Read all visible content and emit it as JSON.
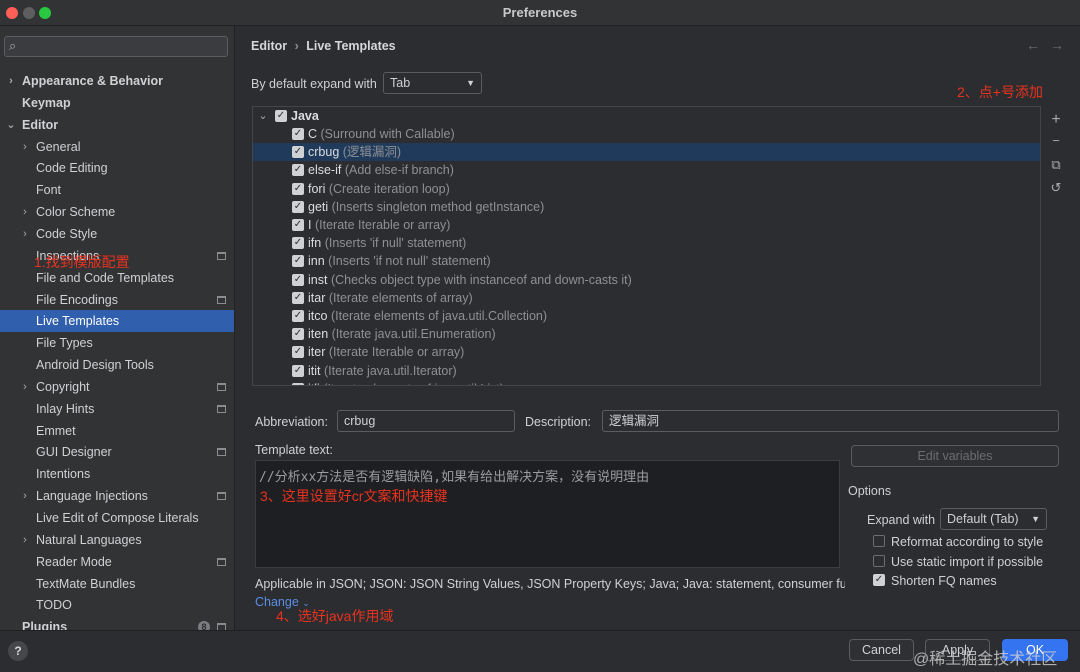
{
  "window": {
    "title": "Preferences"
  },
  "search": {
    "placeholder": ""
  },
  "sidebar": {
    "items": [
      {
        "label": "Appearance & Behavior",
        "level": 0,
        "expandable": true,
        "expanded": false,
        "bold": true
      },
      {
        "label": "Keymap",
        "level": 0,
        "expandable": false,
        "bold": true
      },
      {
        "label": "Editor",
        "level": 0,
        "expandable": true,
        "expanded": true,
        "bold": true
      },
      {
        "label": "General",
        "level": 1,
        "expandable": true
      },
      {
        "label": "Code Editing",
        "level": 1
      },
      {
        "label": "Font",
        "level": 1
      },
      {
        "label": "Color Scheme",
        "level": 1,
        "expandable": true
      },
      {
        "label": "Code Style",
        "level": 1,
        "expandable": true
      },
      {
        "label": "Inspections",
        "level": 1,
        "project_icon": true
      },
      {
        "label": "File and Code Templates",
        "level": 1
      },
      {
        "label": "File Encodings",
        "level": 1,
        "project_icon": true
      },
      {
        "label": "Live Templates",
        "level": 1,
        "selected": true
      },
      {
        "label": "File Types",
        "level": 1
      },
      {
        "label": "Android Design Tools",
        "level": 1
      },
      {
        "label": "Copyright",
        "level": 1,
        "expandable": true,
        "project_icon": true
      },
      {
        "label": "Inlay Hints",
        "level": 1,
        "project_icon": true
      },
      {
        "label": "Emmet",
        "level": 1
      },
      {
        "label": "GUI Designer",
        "level": 1,
        "project_icon": true
      },
      {
        "label": "Intentions",
        "level": 1
      },
      {
        "label": "Language Injections",
        "level": 1,
        "expandable": true,
        "project_icon": true
      },
      {
        "label": "Live Edit of Compose Literals",
        "level": 1
      },
      {
        "label": "Natural Languages",
        "level": 1,
        "expandable": true
      },
      {
        "label": "Reader Mode",
        "level": 1,
        "project_icon": true
      },
      {
        "label": "TextMate Bundles",
        "level": 1
      },
      {
        "label": "TODO",
        "level": 1
      },
      {
        "label": "Plugins",
        "level": 0,
        "bold": true,
        "badge": "8",
        "project_icon": true
      }
    ]
  },
  "breadcrumb": {
    "parent": "Editor",
    "separator": "›",
    "current": "Live Templates"
  },
  "expand_default": {
    "label": "By default expand with",
    "value": "Tab"
  },
  "tree": {
    "group": {
      "name": "Java",
      "checked": true
    },
    "templates": [
      {
        "abbr": "C",
        "desc": "(Surround with Callable)",
        "checked": true
      },
      {
        "abbr": "crbug",
        "desc": "(逻辑漏洞)",
        "checked": true,
        "selected": true
      },
      {
        "abbr": "else-if",
        "desc": "(Add else-if branch)",
        "checked": true
      },
      {
        "abbr": "fori",
        "desc": "(Create iteration loop)",
        "checked": true
      },
      {
        "abbr": "geti",
        "desc": "(Inserts singleton method getInstance)",
        "checked": true
      },
      {
        "abbr": "I",
        "desc": "(Iterate Iterable or array)",
        "checked": true
      },
      {
        "abbr": "ifn",
        "desc": "(Inserts 'if null' statement)",
        "checked": true
      },
      {
        "abbr": "inn",
        "desc": "(Inserts 'if not null' statement)",
        "checked": true
      },
      {
        "abbr": "inst",
        "desc": "(Checks object type with instanceof and down-casts it)",
        "checked": true
      },
      {
        "abbr": "itar",
        "desc": "(Iterate elements of array)",
        "checked": true
      },
      {
        "abbr": "itco",
        "desc": "(Iterate elements of java.util.Collection)",
        "checked": true
      },
      {
        "abbr": "iten",
        "desc": "(Iterate java.util.Enumeration)",
        "checked": true
      },
      {
        "abbr": "iter",
        "desc": "(Iterate Iterable or array)",
        "checked": true
      },
      {
        "abbr": "itit",
        "desc": "(Iterate java.util.Iterator)",
        "checked": true
      },
      {
        "abbr": "itli",
        "desc": "(Iterate elements of java.util.List)",
        "checked": true
      }
    ]
  },
  "toolbar": {
    "add": "+",
    "remove": "−",
    "copy": "⧉",
    "restore": "↺"
  },
  "details": {
    "abbreviation_label": "Abbreviation:",
    "abbreviation_value": "crbug",
    "description_label": "Description:",
    "description_value": "逻辑漏洞",
    "template_text_label": "Template text:",
    "template_text": "//分析xx方法是否有逻辑缺陷,如果有给出解决方案，没有说明理由",
    "applicable": "Applicable in JSON; JSON: JSON String Values, JSON Property Keys; Java; Java: statement, consumer fu...",
    "change_link": "Change"
  },
  "options": {
    "edit_variables": "Edit variables",
    "title": "Options",
    "expand_with_label": "Expand with",
    "expand_with_value": "Default (Tab)",
    "reformat": {
      "label": "Reformat according to style",
      "checked": false
    },
    "static_import": {
      "label": "Use static import if possible",
      "checked": false
    },
    "shorten_fq": {
      "label": "Shorten FQ names",
      "checked": true
    }
  },
  "annotations": {
    "step1": "1.找到模版配置",
    "step2": "2、点+号添加",
    "step3": "3、这里设置好cr文案和快捷键",
    "step4": "4、选好java作用域"
  },
  "buttons": {
    "cancel": "Cancel",
    "apply": "Apply",
    "ok": "OK",
    "help": "?"
  },
  "watermark": "@稀土掘金技术社区",
  "colors": {
    "accent": "#3574f0",
    "selection": "#2f5fad",
    "annotation": "#e8321e"
  }
}
